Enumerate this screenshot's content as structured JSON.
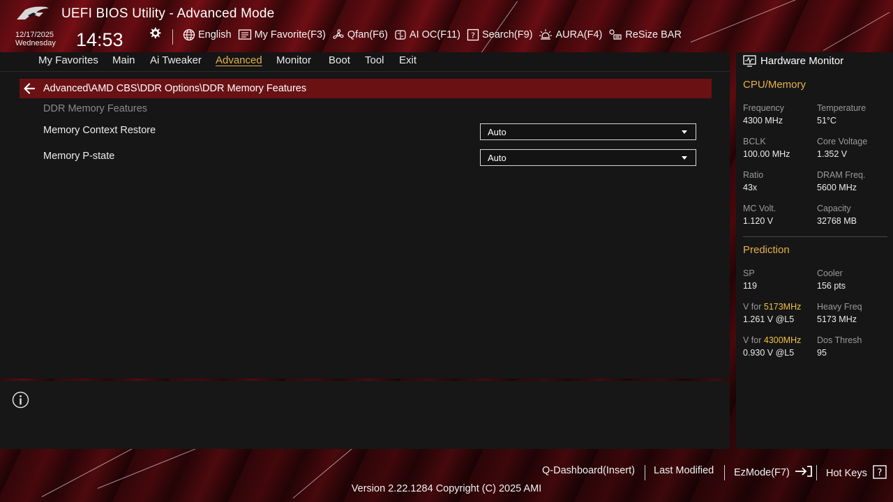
{
  "header": {
    "title": "UEFI BIOS Utility - Advanced Mode",
    "date": "12/17/2025",
    "weekday": "Wednesday",
    "time": "14:53"
  },
  "toolbar": {
    "language": "English",
    "my_favorite": "My Favorite(F3)",
    "qfan": "Qfan(F6)",
    "ai_oc": "AI OC(F11)",
    "search": "Search(F9)",
    "aura": "AURA(F4)",
    "resize_bar": "ReSize BAR"
  },
  "menu": {
    "items": [
      "My Favorites",
      "Main",
      "Ai Tweaker",
      "Advanced",
      "Monitor",
      "Boot",
      "Tool",
      "Exit"
    ],
    "active": "Advanced"
  },
  "breadcrumb": "Advanced\\AMD CBS\\DDR Options\\DDR Memory Features",
  "section_title": "DDR Memory Features",
  "settings": [
    {
      "label": "Memory Context Restore",
      "value": "Auto"
    },
    {
      "label": "Memory P-state",
      "value": "Auto"
    }
  ],
  "hardware_monitor": {
    "title": "Hardware Monitor",
    "cpu_memory": {
      "heading": "CPU/Memory",
      "frequency": {
        "label": "Frequency",
        "value": "4300 MHz"
      },
      "temperature": {
        "label": "Temperature",
        "value": "51°C"
      },
      "bclk": {
        "label": "BCLK",
        "value": "100.00 MHz"
      },
      "core_voltage": {
        "label": "Core Voltage",
        "value": "1.352 V"
      },
      "ratio": {
        "label": "Ratio",
        "value": "43x"
      },
      "dram_freq": {
        "label": "DRAM Freq.",
        "value": "5600 MHz"
      },
      "mc_volt": {
        "label": "MC Volt.",
        "value": "1.120 V"
      },
      "capacity": {
        "label": "Capacity",
        "value": "32768 MB"
      }
    },
    "prediction": {
      "heading": "Prediction",
      "sp": {
        "label": "SP",
        "value": "119"
      },
      "cooler": {
        "label": "Cooler",
        "value": "156 pts"
      },
      "v_for_1": {
        "label_prefix": "V for ",
        "label_freq": "5173MHz",
        "value": "1.261 V @L5"
      },
      "heavy_freq": {
        "label": "Heavy Freq",
        "value": "5173 MHz"
      },
      "v_for_2": {
        "label_prefix": "V for ",
        "label_freq": "4300MHz",
        "value": "0.930 V @L5"
      },
      "dos_thresh": {
        "label": "Dos Thresh",
        "value": "95"
      }
    }
  },
  "footer": {
    "q_dashboard": "Q-Dashboard(Insert)",
    "last_modified": "Last Modified",
    "ezmode": "EzMode(F7)",
    "hot_keys": "Hot Keys",
    "version": "Version 2.22.1284 Copyright (C) 2025 AMI"
  },
  "colors": {
    "accent": "#e8b04a",
    "breadcrumb_bar": "#6a1114",
    "highlight": "#f0c040"
  }
}
